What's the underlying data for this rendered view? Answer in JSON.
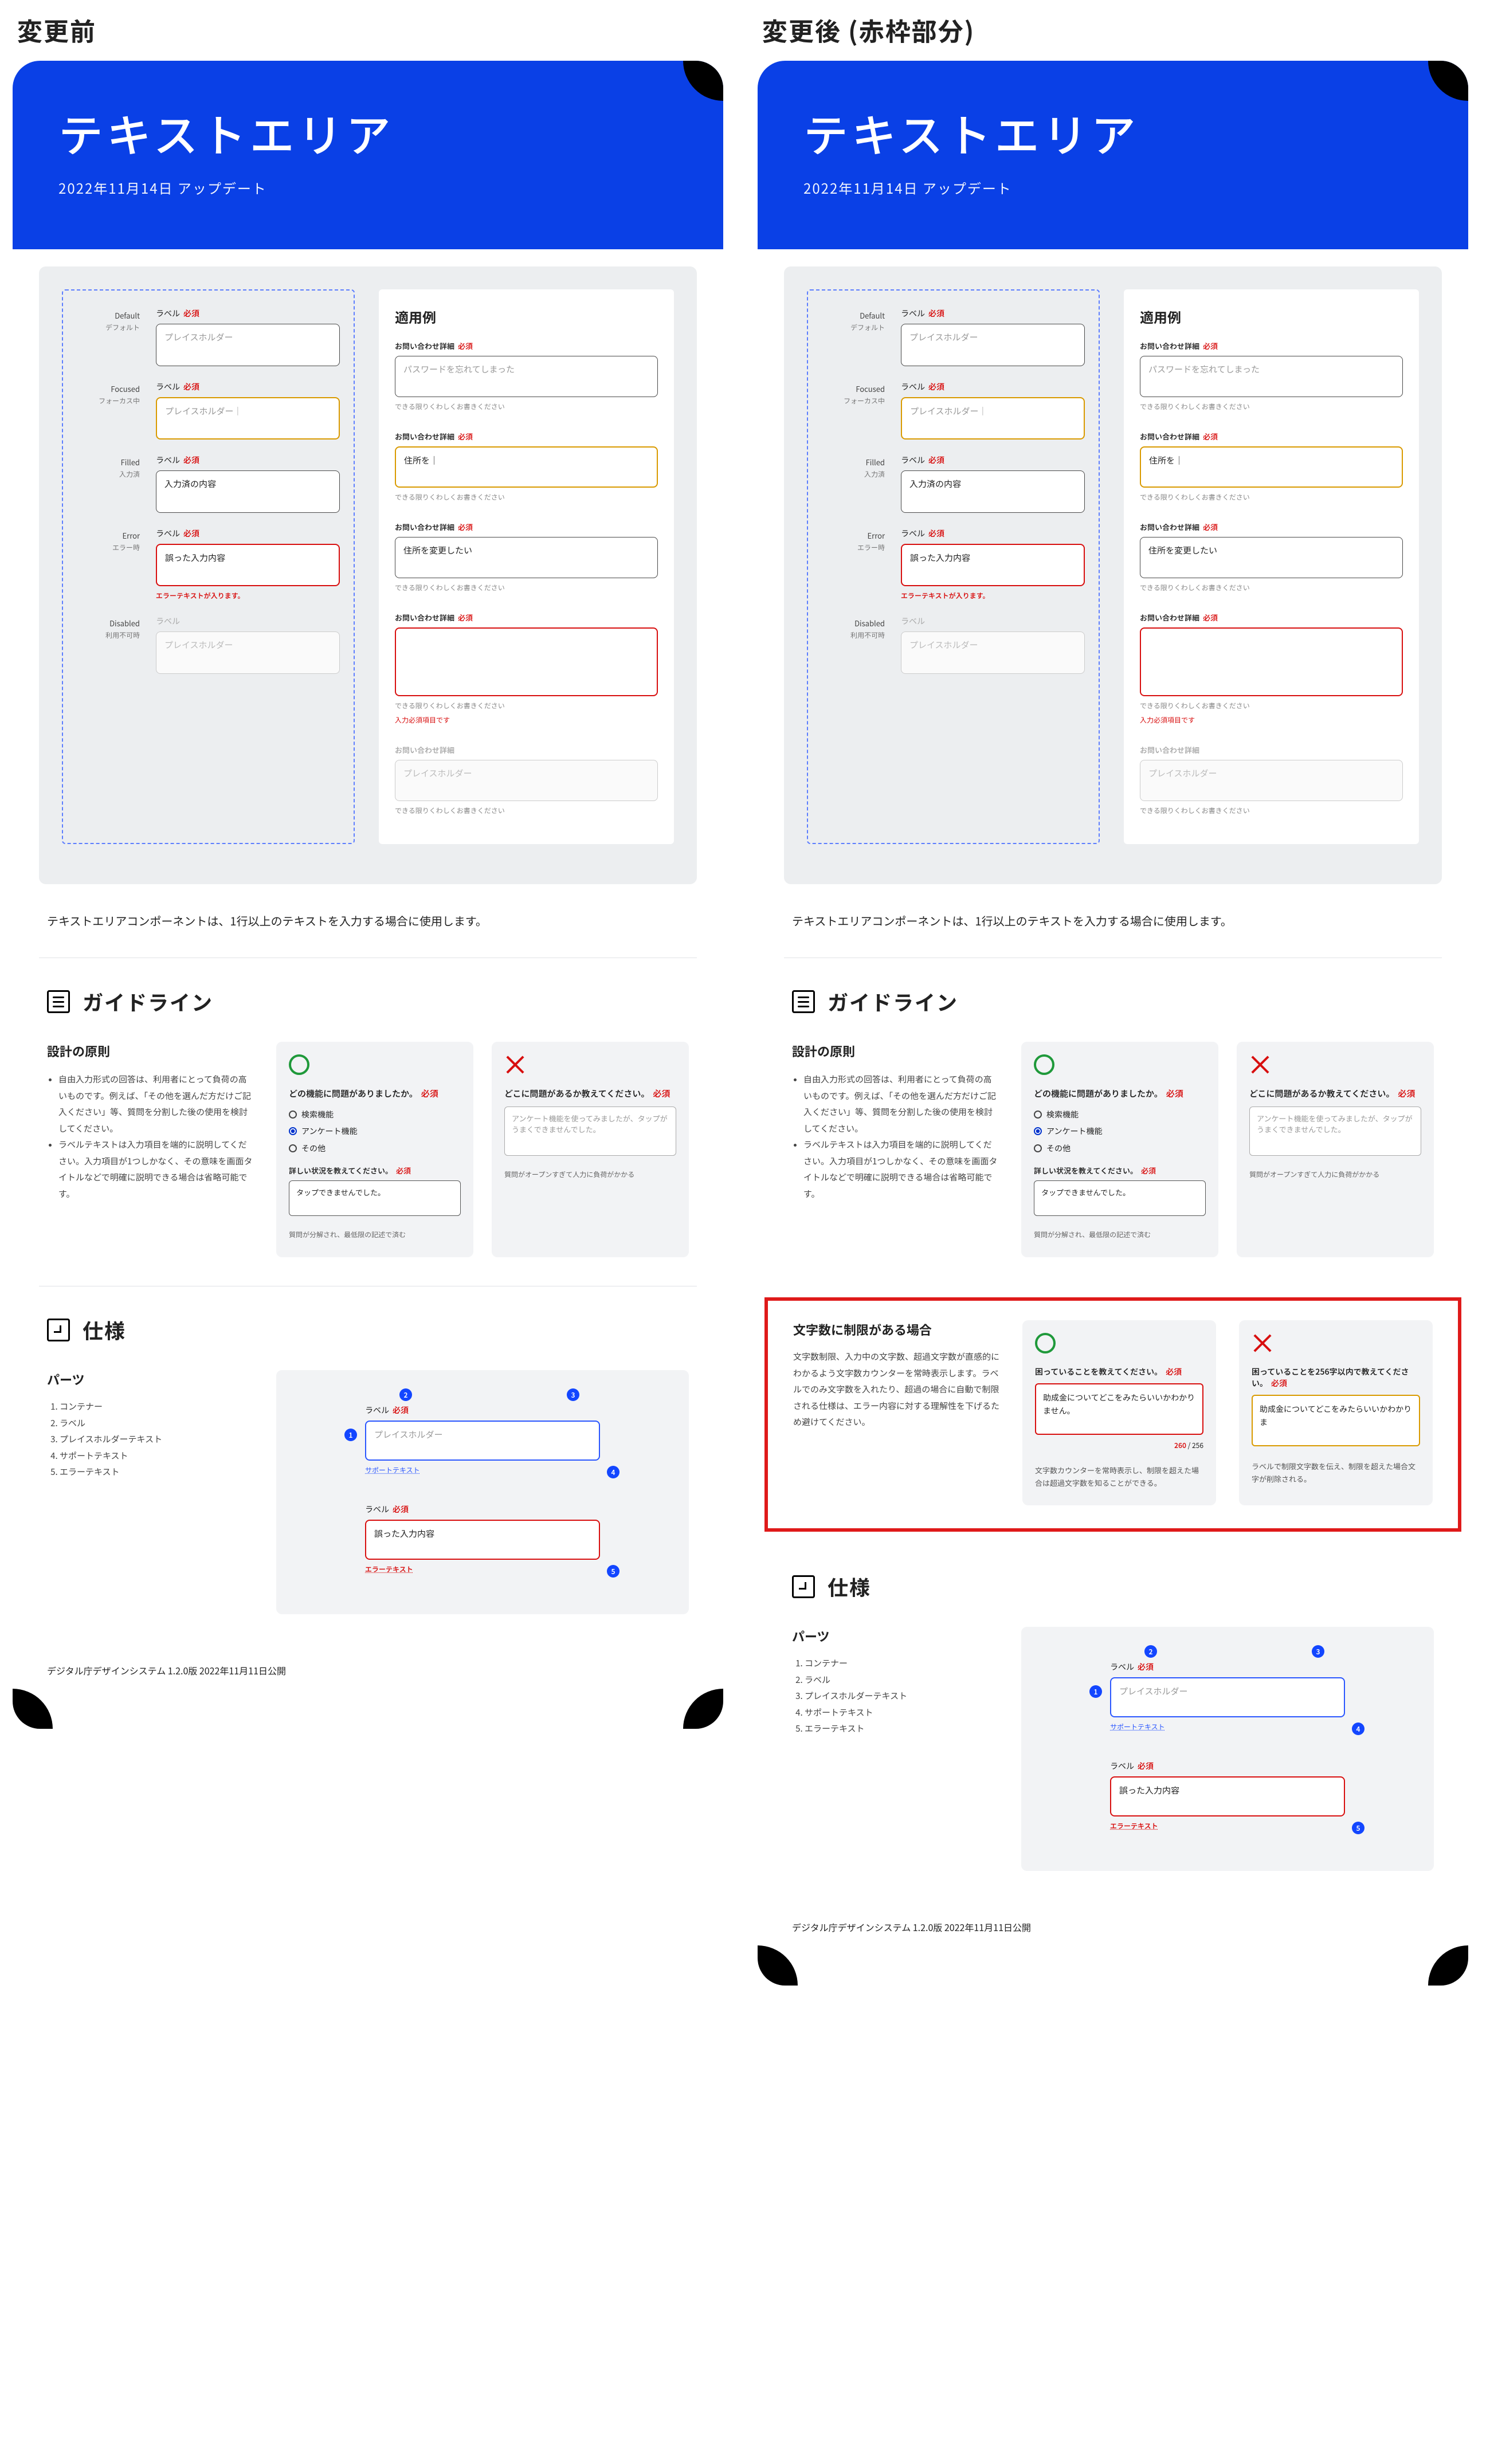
{
  "header_before": "変更前",
  "header_after": "変更後 (赤枠部分)",
  "hero": {
    "title": "テキストエリア",
    "date": "2022年11月14日 アップデート"
  },
  "states": {
    "default": {
      "en": "Default",
      "jp": "デフォルト"
    },
    "focused": {
      "en": "Focused",
      "jp": "フォーカス中"
    },
    "filled": {
      "en": "Filled",
      "jp": "入力済"
    },
    "error": {
      "en": "Error",
      "jp": "エラー時"
    },
    "disabled": {
      "en": "Disabled",
      "jp": "利用不可時"
    }
  },
  "field": {
    "label": "ラベル",
    "required": "必須",
    "placeholder": "プレイスホルダー",
    "placeholder_focus": "プレイスホルダー｜",
    "filled_value": "入力済の内容",
    "error_value": "誤った入力内容",
    "error_hint": "エラーテキストが入ります。"
  },
  "examples": {
    "title": "適用例",
    "label": "お問い合わせ詳細",
    "required": "必須",
    "default_value": "パスワードを忘れてしまった",
    "help_default": "できる限りくわしくお書きください",
    "focus_value": "住所を｜",
    "help_focus": "できる限りくわしくお書きください",
    "filled_value": "住所を変更したい",
    "help_filled": "できる限りくわしくお書きください",
    "error_help": "できる限りくわしくお書きください",
    "error_required_hint": "入力必須項目です",
    "disabled_label": "お問い合わせ詳細",
    "disabled_placeholder": "プレイスホルダー",
    "disabled_help": "できる限りくわしくお書きください"
  },
  "description": "テキストエリアコンポーネントは、1行以上のテキストを入力する場合に使用します。",
  "guidelines_title": "ガイドライン",
  "principles": {
    "title": "設計の原則",
    "bullets": [
      "自由入力形式の回答は、利用者にとって負荷の高いものです。例えば、「その他を選んだ方だけご記入ください」等、質問を分割した後の使用を検討してください。",
      "ラベルテキストは入力項目を端的に説明してください。入力項目が1つしかなく、その意味を画面タイトルなどで明確に説明できる場合は省略可能です。"
    ],
    "good_question": "どの機能に問題がありましたか。",
    "opts": [
      "検索機能",
      "アンケート機能",
      "その他"
    ],
    "sub_question": "詳しい状況を教えてください。",
    "good_answer": "タップできませんでした。",
    "bad_question": "どこに問題があるか教えてください。",
    "bad_placeholder": "アンケート機能を使ってみましたが、タップがうまくできませんでした。",
    "good_caption": "質問が分解され、最低限の記述で済む",
    "bad_caption": "質問がオープンすぎて人力に負荷がかかる"
  },
  "charlimit": {
    "title": "文字数に制限がある場合",
    "body": "文字数制限、入力中の文字数、超過文字数が直感的にわかるよう文字数カウンターを常時表示します。ラベルでのみ文字数を入れたり、超過の場合に自動で制限される仕様は、エラー内容に対する理解性を下げるため避けてください。",
    "good_q": "困っていることを教えてください。",
    "good_value": "助成金についてどこをみたらいいかわかりません。",
    "counter_current": "260",
    "counter_max": "256",
    "good_caption": "文字数カウンターを常時表示し、制限を超えた場合は超過文字数を知ることができる。",
    "bad_q": "困っていることを256字以内で教えてください。",
    "bad_value": "助成金についてどこをみたらいいかわかりま",
    "bad_caption": "ラベルで制限文字数を伝え、制限を超えた場合文字が削除される。"
  },
  "spec_title": "仕様",
  "parts": {
    "title": "パーツ",
    "items": [
      "コンテナー",
      "ラベル",
      "プレイスホルダーテキスト",
      "サポートテキスト",
      "エラーテキスト"
    ],
    "support_text": "サポートテキスト",
    "error_text": "エラーテキスト"
  },
  "footer": "デジタル庁デザインシステム 1.2.0版 2022年11月11日公開"
}
